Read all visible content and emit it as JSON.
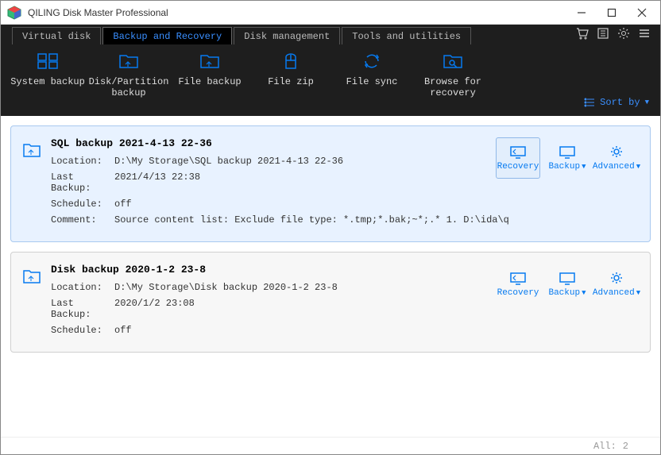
{
  "app": {
    "title": "QILING Disk Master Professional"
  },
  "tabs": {
    "virtual_disk": "Virtual disk",
    "backup_recovery": "Backup and Recovery",
    "disk_management": "Disk management",
    "tools_utilities": "Tools and utilities"
  },
  "toolbar": {
    "system_backup": "System backup",
    "disk_partition": "Disk/Partition backup",
    "file_backup": "File backup",
    "file_zip": "File zip",
    "file_sync": "File sync",
    "browse_recovery": "Browse for recovery",
    "sort_by": "Sort by"
  },
  "tasks": [
    {
      "title": "SQL backup 2021-4-13 22-36",
      "location_label": "Location:",
      "location": "D:\\My Storage\\SQL backup 2021-4-13 22-36",
      "last_backup_label": "Last Backup:",
      "last_backup": "2021/4/13 22:38",
      "schedule_label": "Schedule:",
      "schedule": "off",
      "comment_label": "Comment:",
      "comment": "Source content list:  Exclude file type: *.tmp;*.bak;~*;.*      1. D:\\ida\\q"
    },
    {
      "title": "Disk backup 2020-1-2 23-8",
      "location_label": "Location:",
      "location": "D:\\My Storage\\Disk backup 2020-1-2 23-8",
      "last_backup_label": "Last Backup:",
      "last_backup": "2020/1/2 23:08",
      "schedule_label": "Schedule:",
      "schedule": "off"
    }
  ],
  "actions": {
    "recovery": "Recovery",
    "backup": "Backup",
    "advanced": "Advanced"
  },
  "status": {
    "all_label": "All:",
    "all_count": "2"
  }
}
